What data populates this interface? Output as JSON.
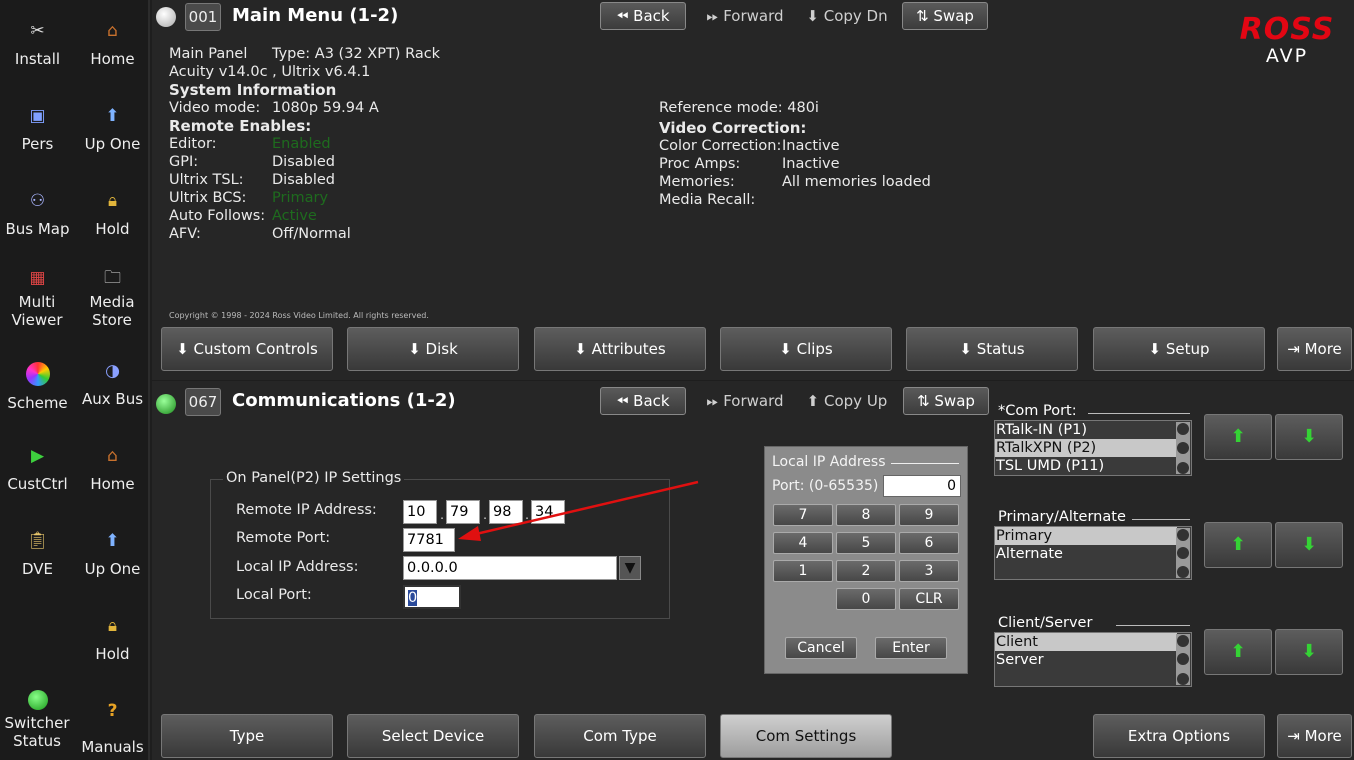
{
  "sidebar": {
    "items": [
      {
        "label": "Install",
        "icon": "tools-icon"
      },
      {
        "label": "Home",
        "icon": "house-icon"
      },
      {
        "label": "Pers",
        "icon": "pers-icon"
      },
      {
        "label": "Up One",
        "icon": "up-arrow-icon"
      },
      {
        "label": "Bus Map",
        "icon": "bus-map-icon"
      },
      {
        "label": "Hold",
        "icon": "lock-icon"
      },
      {
        "label": "Multi Viewer",
        "icon": "multiviewer-icon"
      },
      {
        "label": "Media Store",
        "icon": "folder-icon"
      },
      {
        "label": "Scheme",
        "icon": "color-wheel-icon"
      },
      {
        "label": "Aux Bus",
        "icon": "aux-bus-icon"
      },
      {
        "label": "CustCtrl",
        "icon": "play-icon"
      },
      {
        "label": "Home",
        "icon": "house-icon"
      },
      {
        "label": "DVE",
        "icon": "dve-icon"
      },
      {
        "label": "Up One",
        "icon": "up-arrow-icon"
      },
      {
        "label": "Hold",
        "icon": "lock-icon"
      },
      {
        "label": "Switcher Status",
        "icon": "status-led-icon"
      },
      {
        "label": "Manuals",
        "icon": "question-icon"
      }
    ]
  },
  "top": {
    "menu_number": "001",
    "title": "Main Menu (1-2)",
    "nav": {
      "back": "Back",
      "forward": "Forward",
      "copy": "Copy Dn",
      "swap": "Swap"
    },
    "logo": {
      "brand": "ROSS",
      "product": "AVP"
    },
    "info": {
      "main_panel_label": "Main Panel",
      "type": "Type: A3 (32 XPT) Rack",
      "version": "Acuity v14.0c , Ultrix v6.4.1",
      "system_info": "System Information",
      "video_mode_label": "Video mode:",
      "video_mode": "1080p 59.94 A",
      "remote_enables": "Remote Enables:",
      "editor_label": "Editor:",
      "editor": "Enabled",
      "gpi_label": "GPI:",
      "gpi": "Disabled",
      "ultrix_tsl_label": "Ultrix TSL:",
      "ultrix_tsl": "Disabled",
      "ultrix_bcs_label": "Ultrix BCS:",
      "ultrix_bcs": "Primary",
      "auto_follows_label": "Auto Follows:",
      "auto_follows": "Active",
      "afv_label": "AFV:",
      "afv": "Off/Normal",
      "ref_mode": "Reference mode:  480i",
      "video_correction": "Video Correction:",
      "color_corr_label": "Color Correction:",
      "color_corr": "Inactive",
      "proc_amps_label": "Proc Amps:",
      "proc_amps": "Inactive",
      "memories_label": "Memories:",
      "memories": "All memories loaded",
      "media_recall_label": "Media Recall:"
    },
    "copyright": "Copyright © 1998 - 2024 Ross Video Limited. All rights reserved.",
    "softkeys": [
      "Custom Controls",
      "Disk",
      "Attributes",
      "Clips",
      "Status",
      "Setup"
    ],
    "more": "More"
  },
  "bottom": {
    "menu_number": "067",
    "title": "Communications (1-2)",
    "nav": {
      "back": "Back",
      "forward": "Forward",
      "copy": "Copy Up",
      "swap": "Swap"
    },
    "ip_group": {
      "legend": "On Panel(P2) IP Settings",
      "remote_ip_label": "Remote IP Address:",
      "remote_ip": [
        "10",
        "79",
        "98",
        "34"
      ],
      "remote_port_label": "Remote Port:",
      "remote_port": "7781",
      "local_ip_label": "Local IP Address:",
      "local_ip": "0.0.0.0",
      "local_port_label": "Local  Port:",
      "local_port": "0"
    },
    "keypad": {
      "title": "Local IP Address",
      "port_label": "Port: (0-65535)",
      "port_value": "0",
      "keys": [
        "7",
        "8",
        "9",
        "4",
        "5",
        "6",
        "1",
        "2",
        "3",
        "0",
        "CLR"
      ],
      "cancel": "Cancel",
      "enter": "Enter"
    },
    "lists": [
      {
        "title": "*Com Port:",
        "items": [
          "RTalk-IN  (P1)",
          "RTalkXPN  (P2)",
          "TSL UMD   (P11)"
        ],
        "selected": 1
      },
      {
        "title": "Primary/Alternate",
        "items": [
          "Primary",
          "Alternate"
        ],
        "selected": 0
      },
      {
        "title": "Client/Server",
        "items": [
          "Client",
          "Server"
        ],
        "selected": 0
      }
    ],
    "softkeys": [
      "Type",
      "Select Device",
      "Com Type",
      "Com Settings",
      "Extra Options"
    ],
    "more": "More"
  },
  "colors": {
    "accent_red": "#e30613",
    "arrow_green": "#35d335",
    "annotation": "#e01010"
  }
}
